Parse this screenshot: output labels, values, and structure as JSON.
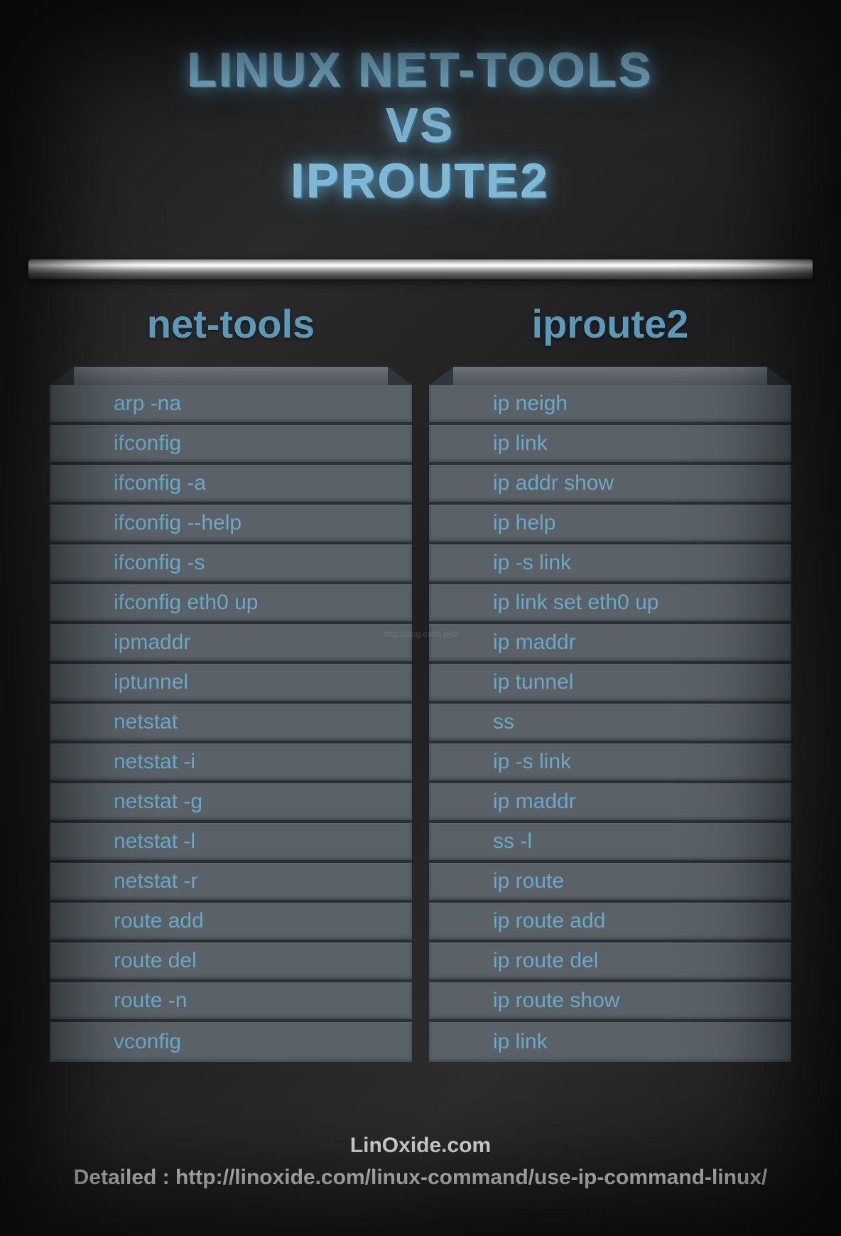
{
  "title": {
    "line1": "LINUX NET-TOOLS",
    "line2": "VS",
    "line3": "IPROUTE2"
  },
  "columns": {
    "left": {
      "header": "net-tools",
      "rows": [
        "arp -na",
        "ifconfig",
        "ifconfig -a",
        "ifconfig --help",
        "ifconfig -s",
        "ifconfig eth0 up",
        "ipmaddr",
        "iptunnel",
        "netstat",
        "netstat -i",
        "netstat  -g",
        "netstat -l",
        "netstat -r",
        "route add",
        "route del",
        "route -n",
        "vconfig"
      ]
    },
    "right": {
      "header": "iproute2",
      "rows": [
        "ip neigh",
        "ip link",
        "ip addr show",
        "ip help",
        "ip -s link",
        "ip link set eth0 up",
        "ip maddr",
        "ip tunnel",
        "ss",
        "ip -s link",
        "ip maddr",
        "ss -l",
        "ip route",
        "ip route add",
        "ip route del",
        "ip route show",
        "ip link"
      ]
    }
  },
  "watermark": "http://blog.csdn.net/",
  "footer": {
    "site": "LinOxide.com",
    "detail": "Detailed : http://linoxide.com/linux-command/use-ip-command-linux/"
  }
}
